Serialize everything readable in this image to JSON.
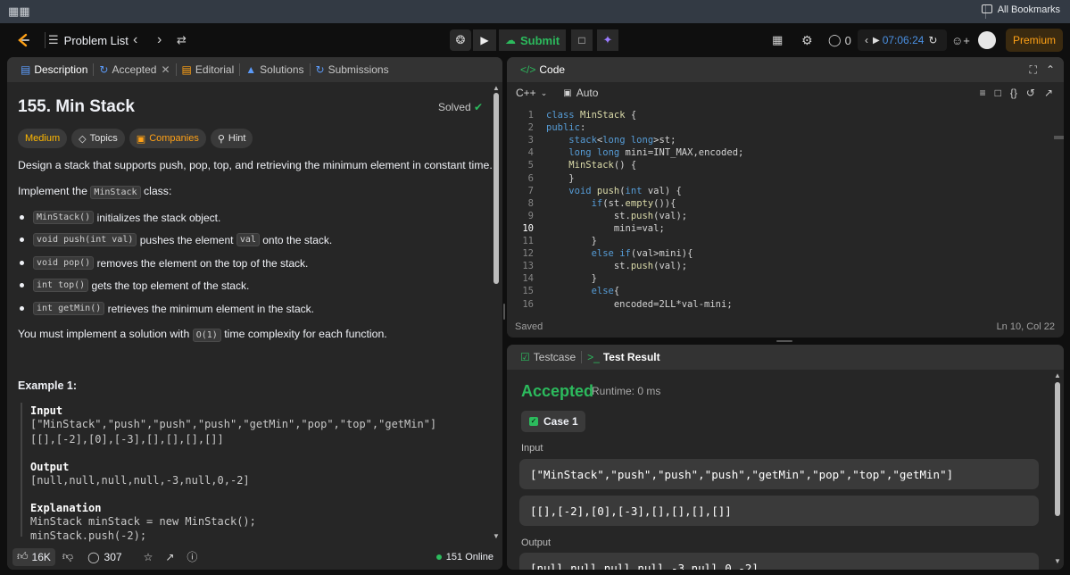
{
  "bookmarks": {
    "all_bookmarks": "All Bookmarks"
  },
  "topnav": {
    "problem_list": "Problem List",
    "submit": "Submit",
    "streak_count": "0",
    "timer": "07:06:24",
    "premium": "Premium"
  },
  "description": {
    "tabs": [
      {
        "label": "Description"
      },
      {
        "label": "Accepted"
      },
      {
        "label": "Editorial"
      },
      {
        "label": "Solutions"
      },
      {
        "label": "Submissions"
      }
    ],
    "title": "155. Min Stack",
    "solved": "Solved",
    "tags": {
      "difficulty": "Medium",
      "topics": "Topics",
      "companies": "Companies",
      "hint": "Hint"
    },
    "intro": "Design a stack that supports push, pop, top, and retrieving the minimum element in constant time.",
    "implement_pre": "Implement the",
    "implement_code": "MinStack",
    "implement_post": "class:",
    "bullets": [
      {
        "code": "MinStack()",
        "text": "initializes the stack object."
      },
      {
        "code": "void push(int val)",
        "text": "pushes the element",
        "code2": "val",
        "text2": "onto the stack."
      },
      {
        "code": "void pop()",
        "text": "removes the element on the top of the stack."
      },
      {
        "code": "int top()",
        "text": "gets the top element of the stack."
      },
      {
        "code": "int getMin()",
        "text": "retrieves the minimum element in the stack."
      }
    ],
    "complexity_pre": "You must implement a solution with",
    "complexity_code": "O(1)",
    "complexity_post": "time complexity for each function.",
    "example_title": "Example 1:",
    "input_label": "Input",
    "input_line1": "[\"MinStack\",\"push\",\"push\",\"push\",\"getMin\",\"pop\",\"top\",\"getMin\"]",
    "input_line2": "[[],[-2],[0],[-3],[],[],[],[]]",
    "output_label": "Output",
    "output_line": "[null,null,null,null,-3,null,0,-2]",
    "explanation_label": "Explanation",
    "expl_line1": "MinStack minStack = new MinStack();",
    "expl_line2": "minStack.push(-2);",
    "likes": "16K",
    "comments": "307",
    "online": "151 Online"
  },
  "code": {
    "title": "Code",
    "language": "C++",
    "auto": "Auto",
    "saved": "Saved",
    "cursor": "Ln 10, Col 22",
    "lines": [
      "class MinStack {",
      "public:",
      "    stack<long long>st;",
      "    long long mini=INT_MAX,encoded;",
      "    MinStack() {",
      "    }",
      "    void push(int val) {",
      "        if(st.empty()){",
      "            st.push(val);",
      "            mini=val;",
      "        }",
      "        else if(val>mini){",
      "            st.push(val);",
      "        }",
      "        else{",
      "            encoded=2LL*val-mini;"
    ]
  },
  "testpanel": {
    "tab_testcase": "Testcase",
    "tab_result": "Test Result",
    "status": "Accepted",
    "runtime": "Runtime: 0 ms",
    "case": "Case 1",
    "input_label": "Input",
    "input_line1": "[\"MinStack\",\"push\",\"push\",\"push\",\"getMin\",\"pop\",\"top\",\"getMin\"]",
    "input_line2": "[[],[-2],[0],[-3],[],[],[],[]]",
    "output_label": "Output",
    "output_line": "[null,null,null,null,-3,null,0,-2]"
  },
  "colors": {
    "accent_green": "#2cbb5d",
    "medium": "#ffb800",
    "premium": "#ffa116",
    "link_blue": "#4a90e2"
  }
}
